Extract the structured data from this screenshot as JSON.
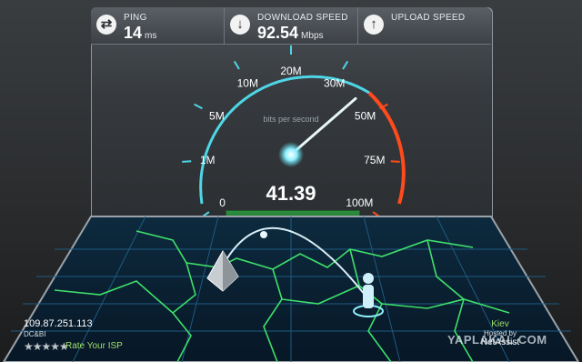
{
  "header": {
    "ping": {
      "label": "PING",
      "value": "14",
      "unit": "ms"
    },
    "download": {
      "label": "DOWNLOAD SPEED",
      "value": "92.54",
      "unit": "Mbps"
    },
    "upload": {
      "label": "UPLOAD SPEED",
      "value": "",
      "unit": ""
    }
  },
  "gauge": {
    "caption": "bits per second",
    "current_value": "41.39",
    "needle_value_mbps": 41.39,
    "ticks": [
      "0",
      "1M",
      "5M",
      "10M",
      "20M",
      "30M",
      "50M",
      "75M",
      "100M"
    ],
    "accent_color": "#4fd6e6",
    "red_zone_color": "#ff4a1c"
  },
  "client": {
    "ip": "109.87.251.113",
    "isp": "DC&BI",
    "rate_label": "Rate Your ISP",
    "stars": "★★★★★"
  },
  "server": {
    "city": "Kiev",
    "hosted_by": "Hosted by",
    "org": "NetAssist"
  },
  "watermark": "YAPLAKAL.COM"
}
